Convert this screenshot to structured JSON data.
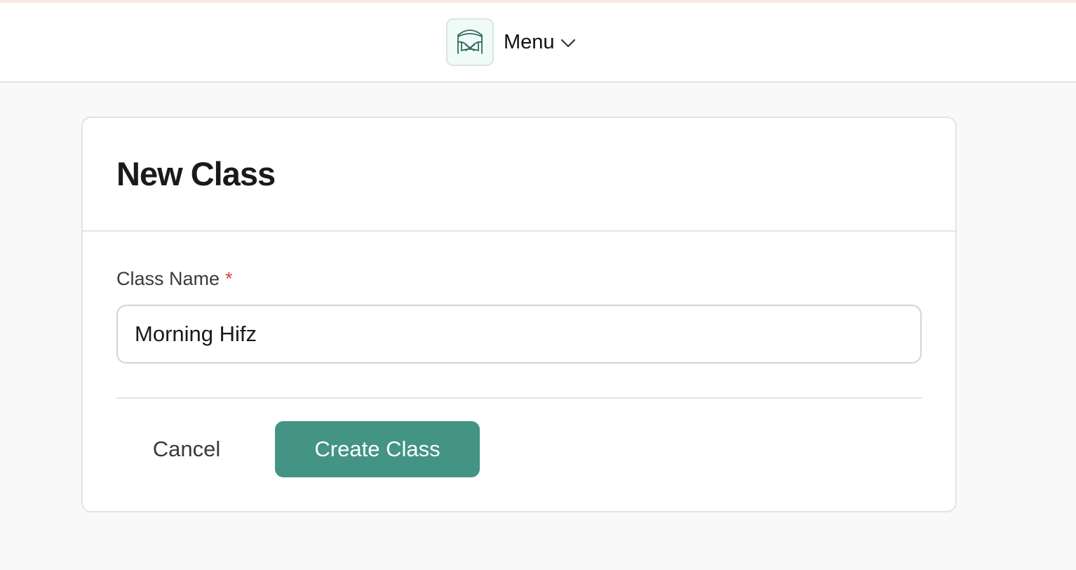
{
  "header": {
    "logo_icon": "book-arch-icon",
    "menu_label": "Menu",
    "menu_chevron_icon": "chevron-down-icon"
  },
  "form": {
    "title": "New Class",
    "class_name_label": "Class Name",
    "required_marker": "*",
    "class_name_value": "Morning Hifz",
    "cancel_label": "Cancel",
    "submit_label": "Create Class"
  },
  "colors": {
    "accent": "#439485",
    "logo_stroke": "#2f6b5e",
    "logo_bg": "#f0faf7",
    "required": "#d64545",
    "page_bg": "#f9f9f9",
    "top_strip": "#fbe9e4"
  }
}
